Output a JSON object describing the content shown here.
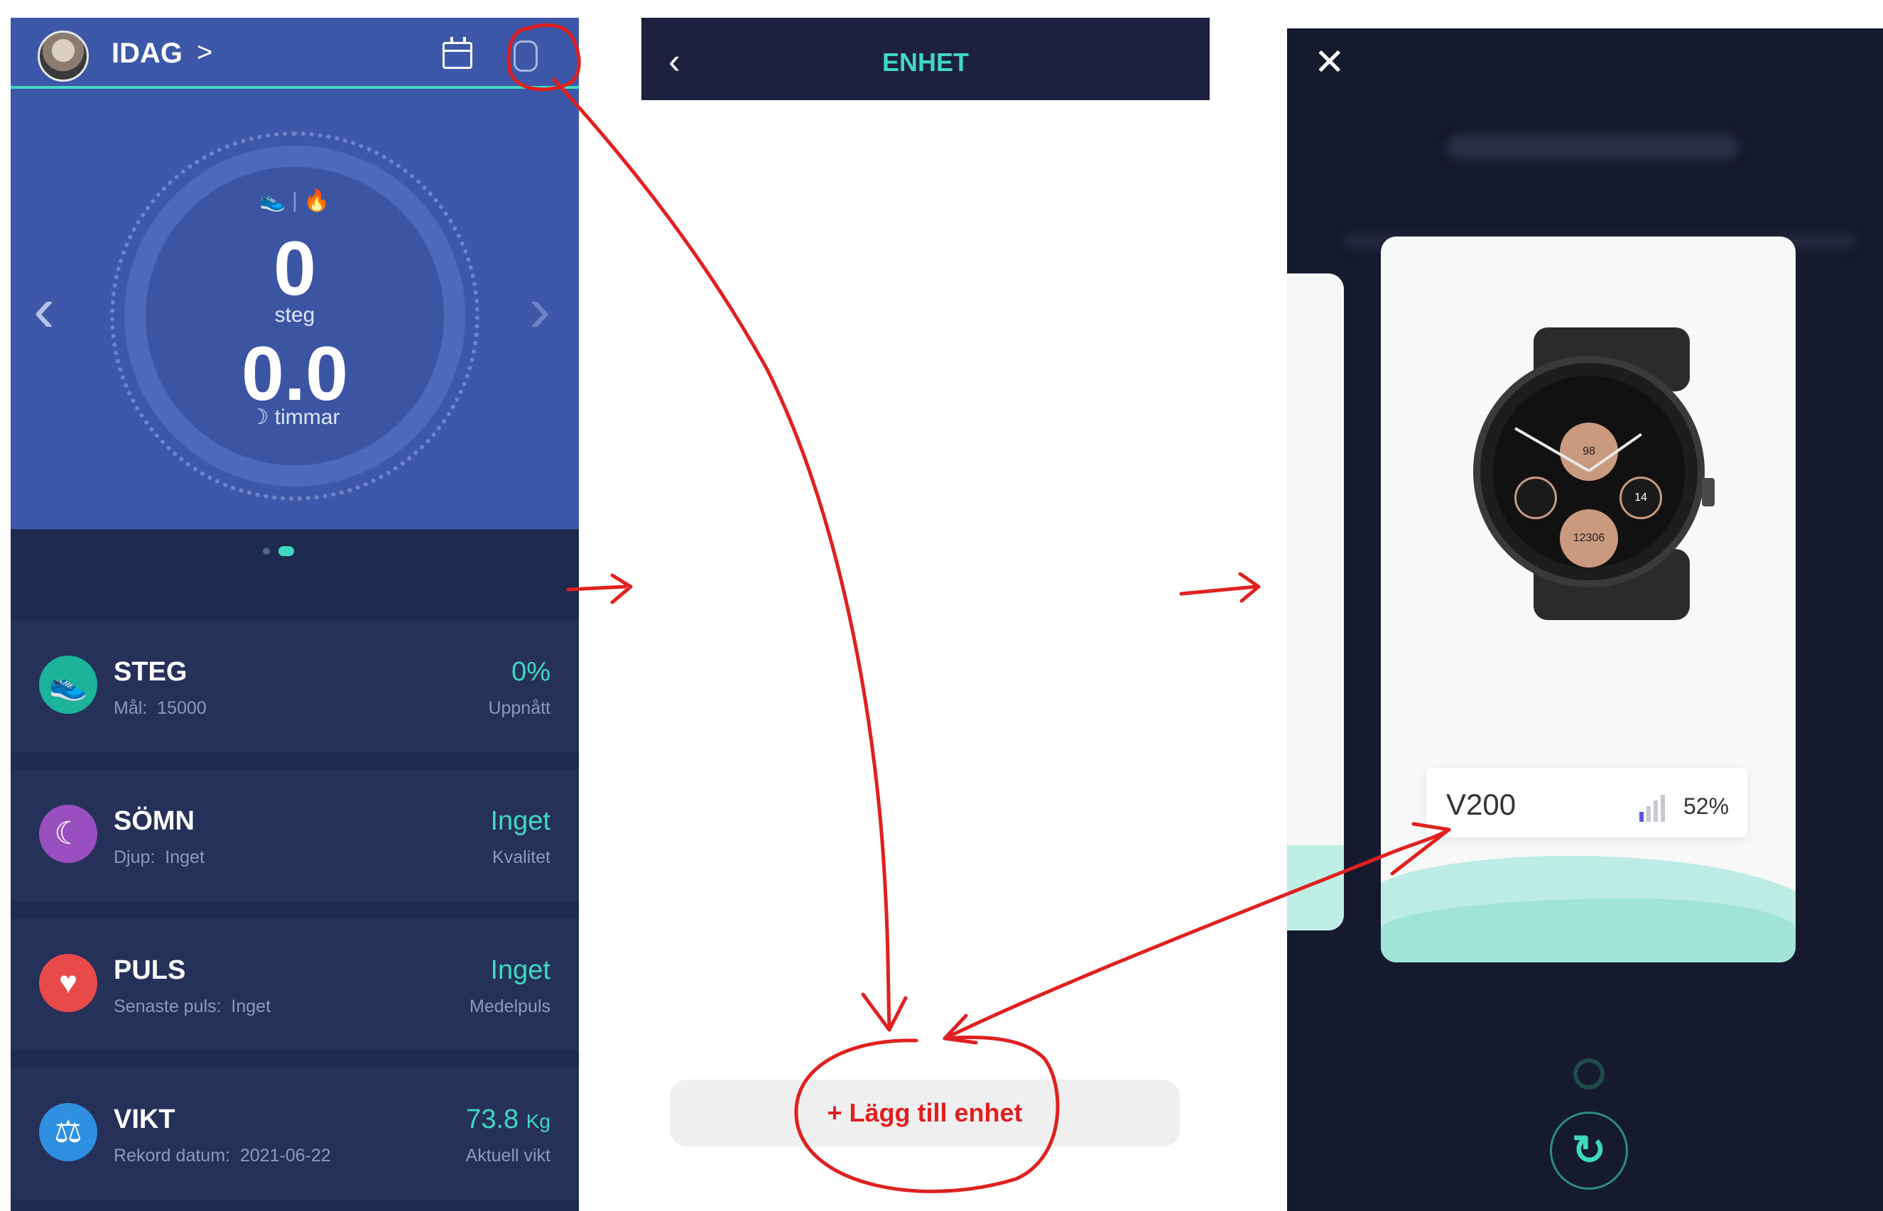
{
  "panel1": {
    "header": {
      "title": "IDAG",
      "title_chevron": ">"
    },
    "dial": {
      "steps_value": "0",
      "steps_label": "steg",
      "hours_value": "0.0",
      "hours_label": "timmar",
      "nav_left": "‹",
      "nav_right": "›"
    },
    "cards": [
      {
        "name": "STEG",
        "sub_label": "Mål:",
        "sub_value": "15000",
        "value": "0%",
        "value_label": "Uppnått",
        "icon": "shoe-icon",
        "color": "#1bb39a"
      },
      {
        "name": "SÖMN",
        "sub_label": "Djup:",
        "sub_value": "Inget",
        "value": "Inget",
        "value_label": "Kvalitet",
        "icon": "moon-icon",
        "color": "#9a4fc0"
      },
      {
        "name": "PULS",
        "sub_label": "Senaste puls:",
        "sub_value": "Inget",
        "value": "Inget",
        "value_label": "Medelpuls",
        "icon": "heart-icon",
        "color": "#e84a4a"
      },
      {
        "name": "VIKT",
        "sub_label": "Rekord datum:",
        "sub_value": "2021-06-22",
        "value": "73.8",
        "value_unit": "Kg",
        "value_label": "Aktuell vikt",
        "icon": "scale-icon",
        "color": "#2f8fe0"
      }
    ]
  },
  "panel2": {
    "header": {
      "title": "ENHET"
    },
    "add_button": "+ Lägg till enhet"
  },
  "panel3": {
    "device": {
      "name": "V200",
      "battery": "52%"
    },
    "watch_face": {
      "sub_top": "98",
      "sub_right": "14",
      "sub_bottom": "12306"
    }
  },
  "colors": {
    "accent": "#3fd8c0",
    "annotation": "#e02020",
    "dark_bg": "#1e2a50",
    "hero_bg": "#3d58a8"
  }
}
